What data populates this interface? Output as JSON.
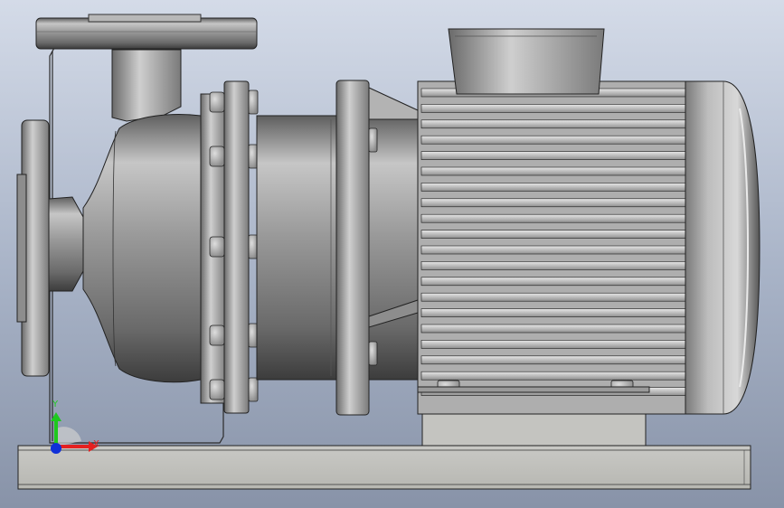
{
  "viewport": {
    "background_top": "#d4dbe8",
    "background_bottom": "#8893a8"
  },
  "model": {
    "part_color": "#a9a9a9",
    "edge_color": "#1a1a1a"
  },
  "triad": {
    "x_label": "X",
    "y_label": "Y",
    "x_color": "#e52020",
    "y_color": "#1ec81e",
    "z_color": "#1030d8"
  }
}
